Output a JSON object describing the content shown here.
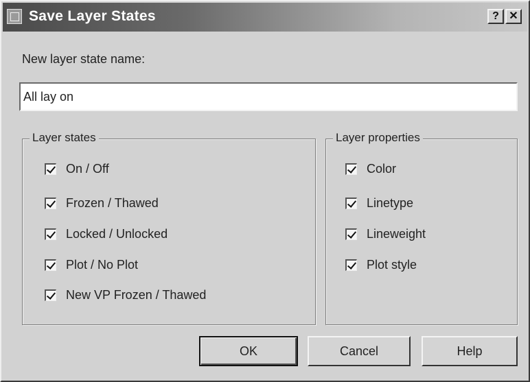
{
  "window": {
    "title": "Save Layer States",
    "help_glyph": "?",
    "close_glyph": "✕"
  },
  "name_field": {
    "label": "New layer state name:",
    "value": "All lay on"
  },
  "layer_states": {
    "title": "Layer states",
    "items": [
      {
        "label": "On / Off",
        "checked": true
      },
      {
        "label": "Frozen / Thawed",
        "checked": true
      },
      {
        "label": "Locked / Unlocked",
        "checked": true
      },
      {
        "label": "Plot / No Plot",
        "checked": true
      },
      {
        "label": "New VP Frozen / Thawed",
        "checked": true
      }
    ]
  },
  "layer_properties": {
    "title": "Layer properties",
    "items": [
      {
        "label": "Color",
        "checked": true
      },
      {
        "label": "Linetype",
        "checked": true
      },
      {
        "label": "Lineweight",
        "checked": true
      },
      {
        "label": "Plot style",
        "checked": true
      }
    ]
  },
  "buttons": {
    "ok": "OK",
    "cancel": "Cancel",
    "help": "Help"
  }
}
